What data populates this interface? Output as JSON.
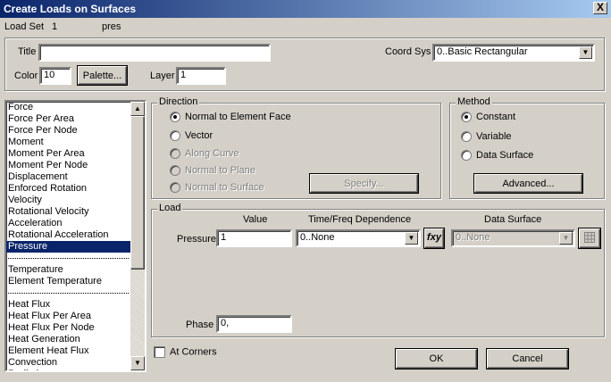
{
  "window": {
    "title": "Create Loads on Surfaces",
    "close_glyph": "X"
  },
  "load_set": {
    "label": "Load Set",
    "number": "1",
    "name": "pres"
  },
  "header": {
    "title_label": "Title",
    "title_value": "",
    "coord_sys_label": "Coord Sys",
    "coord_sys_value": "0..Basic Rectangular",
    "color_label": "Color",
    "color_value": "10",
    "palette_button": "Palette...",
    "layer_label": "Layer",
    "layer_value": "1"
  },
  "load_types": {
    "items": [
      "Force",
      "Force Per Area",
      "Force Per Node",
      "Moment",
      "Moment Per Area",
      "Moment Per Node",
      "Displacement",
      "Enforced Rotation",
      "Velocity",
      "Rotational Velocity",
      "Acceleration",
      "Rotational Acceleration",
      "Pressure",
      "---",
      "Temperature",
      "Element Temperature",
      "---",
      "Heat Flux",
      "Heat Flux Per Area",
      "Heat Flux Per Node",
      "Heat Generation",
      "Element Heat Flux",
      "Convection",
      "Radiation"
    ],
    "selected": "Pressure"
  },
  "direction": {
    "label": "Direction",
    "options": [
      {
        "label": "Normal to Element Face",
        "checked": true,
        "enabled": true
      },
      {
        "label": "Vector",
        "checked": false,
        "enabled": true
      },
      {
        "label": "Along Curve",
        "checked": false,
        "enabled": false
      },
      {
        "label": "Normal to Plane",
        "checked": false,
        "enabled": false
      },
      {
        "label": "Normal to Surface",
        "checked": false,
        "enabled": false
      }
    ],
    "specify_button": "Specify..."
  },
  "method": {
    "label": "Method",
    "options": [
      {
        "label": "Constant",
        "checked": true
      },
      {
        "label": "Variable",
        "checked": false
      },
      {
        "label": "Data Surface",
        "checked": false
      }
    ],
    "advanced_button": "Advanced..."
  },
  "load": {
    "label": "Load",
    "col_value": "Value",
    "col_time": "Time/Freq Dependence",
    "col_surface": "Data Surface",
    "pressure_label": "Pressure",
    "pressure_value": "1",
    "time_value": "0..None",
    "fxy_label": "fxy",
    "surface_value": "0..None",
    "phase_label": "Phase",
    "phase_value": "0,"
  },
  "at_corners": {
    "label": "At Corners",
    "checked": false
  },
  "buttons": {
    "ok": "OK",
    "cancel": "Cancel"
  }
}
